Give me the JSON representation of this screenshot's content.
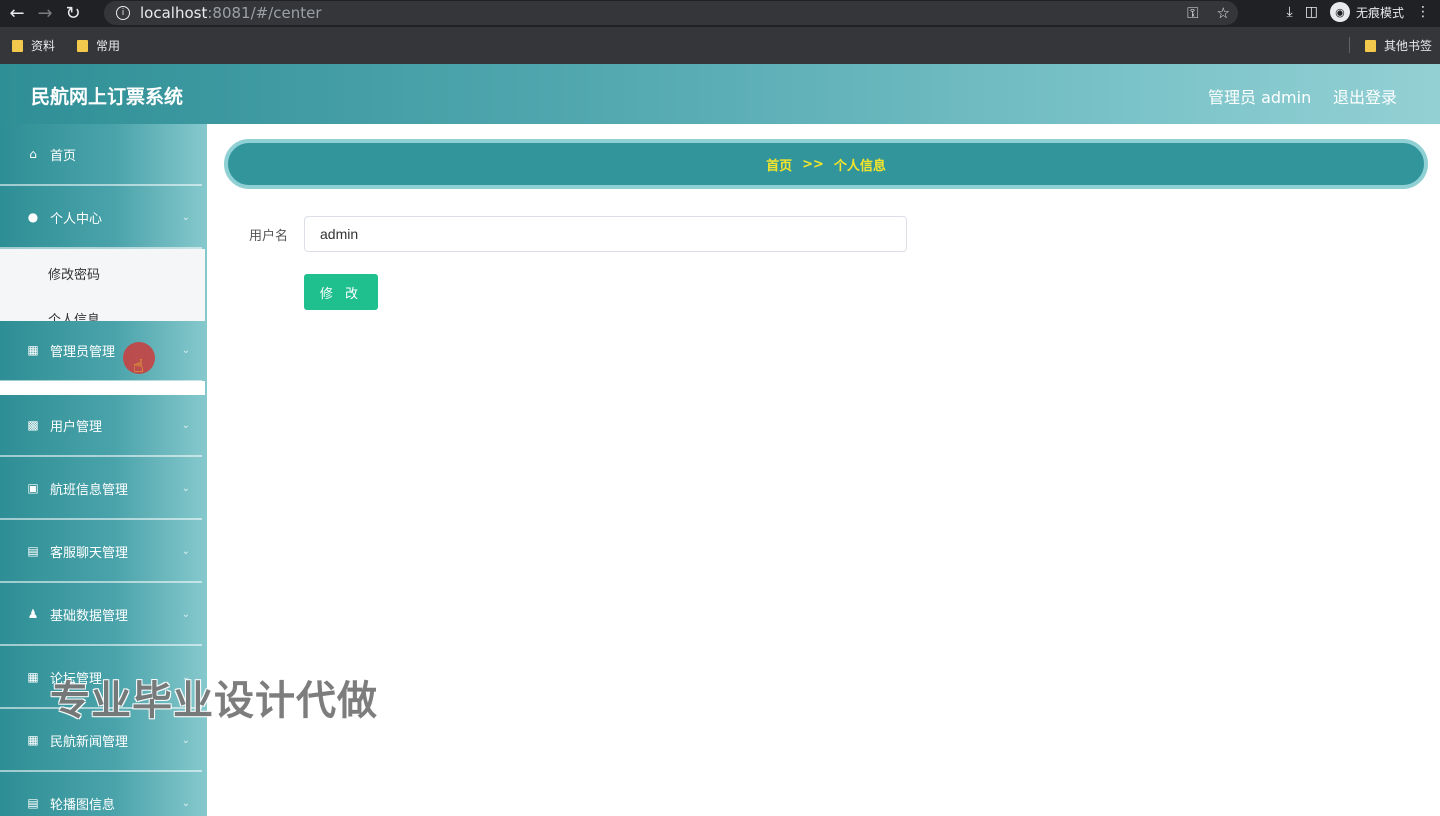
{
  "browser": {
    "url_host": "localhost",
    "url_rest": ":8081/#/center",
    "incognito_label": "无痕模式",
    "bookmarks": [
      "资料",
      "常用"
    ],
    "other_bookmarks": "其他书签"
  },
  "header": {
    "title": "民航网上订票系统",
    "user": "管理员 admin",
    "logout": "退出登录"
  },
  "sidebar": {
    "items": [
      {
        "label": "首页",
        "icon": "home-icon"
      },
      {
        "label": "个人中心",
        "icon": "user-icon"
      },
      {
        "label": "管理员管理",
        "icon": "grid-icon"
      },
      {
        "label": "用户管理",
        "icon": "chart-icon"
      },
      {
        "label": "航班信息管理",
        "icon": "monitor-icon"
      },
      {
        "label": "客服聊天管理",
        "icon": "chat-icon"
      },
      {
        "label": "基础数据管理",
        "icon": "person-icon"
      },
      {
        "label": "论坛管理",
        "icon": "grid-icon"
      },
      {
        "label": "民航新闻管理",
        "icon": "grid-icon"
      },
      {
        "label": "轮播图信息",
        "icon": "document-icon"
      }
    ],
    "submenu": [
      "修改密码",
      "个人信息"
    ]
  },
  "breadcrumb": {
    "home": "首页",
    "separator": ">>",
    "current": "个人信息"
  },
  "form": {
    "username_label": "用户名",
    "username_value": "admin",
    "submit_label": "修 改"
  },
  "watermark": "专业毕业设计代做"
}
